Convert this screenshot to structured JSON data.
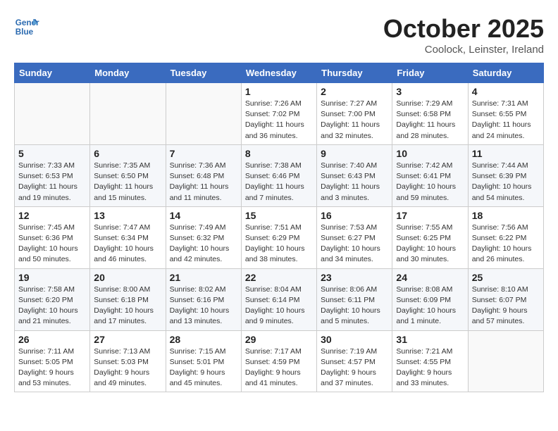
{
  "logo": {
    "line1": "General",
    "line2": "Blue"
  },
  "title": "October 2025",
  "location": "Coolock, Leinster, Ireland",
  "weekdays": [
    "Sunday",
    "Monday",
    "Tuesday",
    "Wednesday",
    "Thursday",
    "Friday",
    "Saturday"
  ],
  "weeks": [
    [
      {
        "day": "",
        "info": ""
      },
      {
        "day": "",
        "info": ""
      },
      {
        "day": "",
        "info": ""
      },
      {
        "day": "1",
        "info": "Sunrise: 7:26 AM\nSunset: 7:02 PM\nDaylight: 11 hours\nand 36 minutes."
      },
      {
        "day": "2",
        "info": "Sunrise: 7:27 AM\nSunset: 7:00 PM\nDaylight: 11 hours\nand 32 minutes."
      },
      {
        "day": "3",
        "info": "Sunrise: 7:29 AM\nSunset: 6:58 PM\nDaylight: 11 hours\nand 28 minutes."
      },
      {
        "day": "4",
        "info": "Sunrise: 7:31 AM\nSunset: 6:55 PM\nDaylight: 11 hours\nand 24 minutes."
      }
    ],
    [
      {
        "day": "5",
        "info": "Sunrise: 7:33 AM\nSunset: 6:53 PM\nDaylight: 11 hours\nand 19 minutes."
      },
      {
        "day": "6",
        "info": "Sunrise: 7:35 AM\nSunset: 6:50 PM\nDaylight: 11 hours\nand 15 minutes."
      },
      {
        "day": "7",
        "info": "Sunrise: 7:36 AM\nSunset: 6:48 PM\nDaylight: 11 hours\nand 11 minutes."
      },
      {
        "day": "8",
        "info": "Sunrise: 7:38 AM\nSunset: 6:46 PM\nDaylight: 11 hours\nand 7 minutes."
      },
      {
        "day": "9",
        "info": "Sunrise: 7:40 AM\nSunset: 6:43 PM\nDaylight: 11 hours\nand 3 minutes."
      },
      {
        "day": "10",
        "info": "Sunrise: 7:42 AM\nSunset: 6:41 PM\nDaylight: 10 hours\nand 59 minutes."
      },
      {
        "day": "11",
        "info": "Sunrise: 7:44 AM\nSunset: 6:39 PM\nDaylight: 10 hours\nand 54 minutes."
      }
    ],
    [
      {
        "day": "12",
        "info": "Sunrise: 7:45 AM\nSunset: 6:36 PM\nDaylight: 10 hours\nand 50 minutes."
      },
      {
        "day": "13",
        "info": "Sunrise: 7:47 AM\nSunset: 6:34 PM\nDaylight: 10 hours\nand 46 minutes."
      },
      {
        "day": "14",
        "info": "Sunrise: 7:49 AM\nSunset: 6:32 PM\nDaylight: 10 hours\nand 42 minutes."
      },
      {
        "day": "15",
        "info": "Sunrise: 7:51 AM\nSunset: 6:29 PM\nDaylight: 10 hours\nand 38 minutes."
      },
      {
        "day": "16",
        "info": "Sunrise: 7:53 AM\nSunset: 6:27 PM\nDaylight: 10 hours\nand 34 minutes."
      },
      {
        "day": "17",
        "info": "Sunrise: 7:55 AM\nSunset: 6:25 PM\nDaylight: 10 hours\nand 30 minutes."
      },
      {
        "day": "18",
        "info": "Sunrise: 7:56 AM\nSunset: 6:22 PM\nDaylight: 10 hours\nand 26 minutes."
      }
    ],
    [
      {
        "day": "19",
        "info": "Sunrise: 7:58 AM\nSunset: 6:20 PM\nDaylight: 10 hours\nand 21 minutes."
      },
      {
        "day": "20",
        "info": "Sunrise: 8:00 AM\nSunset: 6:18 PM\nDaylight: 10 hours\nand 17 minutes."
      },
      {
        "day": "21",
        "info": "Sunrise: 8:02 AM\nSunset: 6:16 PM\nDaylight: 10 hours\nand 13 minutes."
      },
      {
        "day": "22",
        "info": "Sunrise: 8:04 AM\nSunset: 6:14 PM\nDaylight: 10 hours\nand 9 minutes."
      },
      {
        "day": "23",
        "info": "Sunrise: 8:06 AM\nSunset: 6:11 PM\nDaylight: 10 hours\nand 5 minutes."
      },
      {
        "day": "24",
        "info": "Sunrise: 8:08 AM\nSunset: 6:09 PM\nDaylight: 10 hours\nand 1 minute."
      },
      {
        "day": "25",
        "info": "Sunrise: 8:10 AM\nSunset: 6:07 PM\nDaylight: 9 hours\nand 57 minutes."
      }
    ],
    [
      {
        "day": "26",
        "info": "Sunrise: 7:11 AM\nSunset: 5:05 PM\nDaylight: 9 hours\nand 53 minutes."
      },
      {
        "day": "27",
        "info": "Sunrise: 7:13 AM\nSunset: 5:03 PM\nDaylight: 9 hours\nand 49 minutes."
      },
      {
        "day": "28",
        "info": "Sunrise: 7:15 AM\nSunset: 5:01 PM\nDaylight: 9 hours\nand 45 minutes."
      },
      {
        "day": "29",
        "info": "Sunrise: 7:17 AM\nSunset: 4:59 PM\nDaylight: 9 hours\nand 41 minutes."
      },
      {
        "day": "30",
        "info": "Sunrise: 7:19 AM\nSunset: 4:57 PM\nDaylight: 9 hours\nand 37 minutes."
      },
      {
        "day": "31",
        "info": "Sunrise: 7:21 AM\nSunset: 4:55 PM\nDaylight: 9 hours\nand 33 minutes."
      },
      {
        "day": "",
        "info": ""
      }
    ]
  ]
}
